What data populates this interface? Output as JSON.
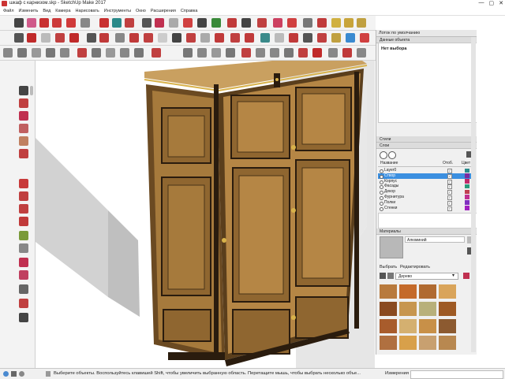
{
  "window": {
    "title": "шкаф с карнизом.skp - SketchUp Make 2017",
    "controls": [
      "—",
      "▢",
      "✕"
    ]
  },
  "menu": [
    "Файл",
    "Изменить",
    "Вид",
    "Камера",
    "Нарисовать",
    "Инструменты",
    "Окно",
    "Расширения",
    "Справка"
  ],
  "tray": {
    "title": "Лоток по умолчанию",
    "entity_info": {
      "header": "Данные объекта",
      "selection": "Нет выбора"
    },
    "styles_header": "Стили",
    "tags": {
      "header": "Слои",
      "columns": {
        "name": "Название",
        "visible": "Отоб.",
        "color": "Цвет"
      },
      "rows": [
        {
          "name": "Layer0",
          "color": "#2a8c8c"
        },
        {
          "name": "Створ",
          "color": "#7a2aa0"
        },
        {
          "name": "Корпус",
          "color": "#c02a6a"
        },
        {
          "name": "Фасады",
          "color": "#2a9a7a"
        },
        {
          "name": "Декор",
          "color": "#c04050"
        },
        {
          "name": "Фурнитура",
          "color": "#c03090"
        },
        {
          "name": "Полки",
          "color": "#8030c0"
        },
        {
          "name": "Стенки",
          "color": "#a020c0"
        }
      ]
    },
    "materials": {
      "header": "Материалы",
      "current": "Алюминий",
      "tab_select": "Выбрать",
      "tab_edit": "Редактировать",
      "library": "Дерево",
      "swatches": [
        "#b87a3d",
        "#c46a2a",
        "#b06a30",
        "#d9a45a",
        "#8a4a20",
        "#c7964f",
        "#b8b07a",
        "#9e5a24",
        "#a85c2c",
        "#d4b070",
        "#c89048",
        "#8c5a30",
        "#b07040",
        "#d8a04a",
        "#c8a070",
        "#b88850"
      ]
    }
  },
  "status": {
    "text": "Выберите объекты. Воспользуйтесь клавишей Shift, чтобы увеличить выбранную область. Перетащите мышь, чтобы выбрать несколько объе...",
    "measure_label": "Измерения"
  },
  "colors": {
    "wood": "#a67a3c",
    "wood_dark": "#6b4a22",
    "trim": "#2a1c0e",
    "gold": "#d8b24a"
  }
}
